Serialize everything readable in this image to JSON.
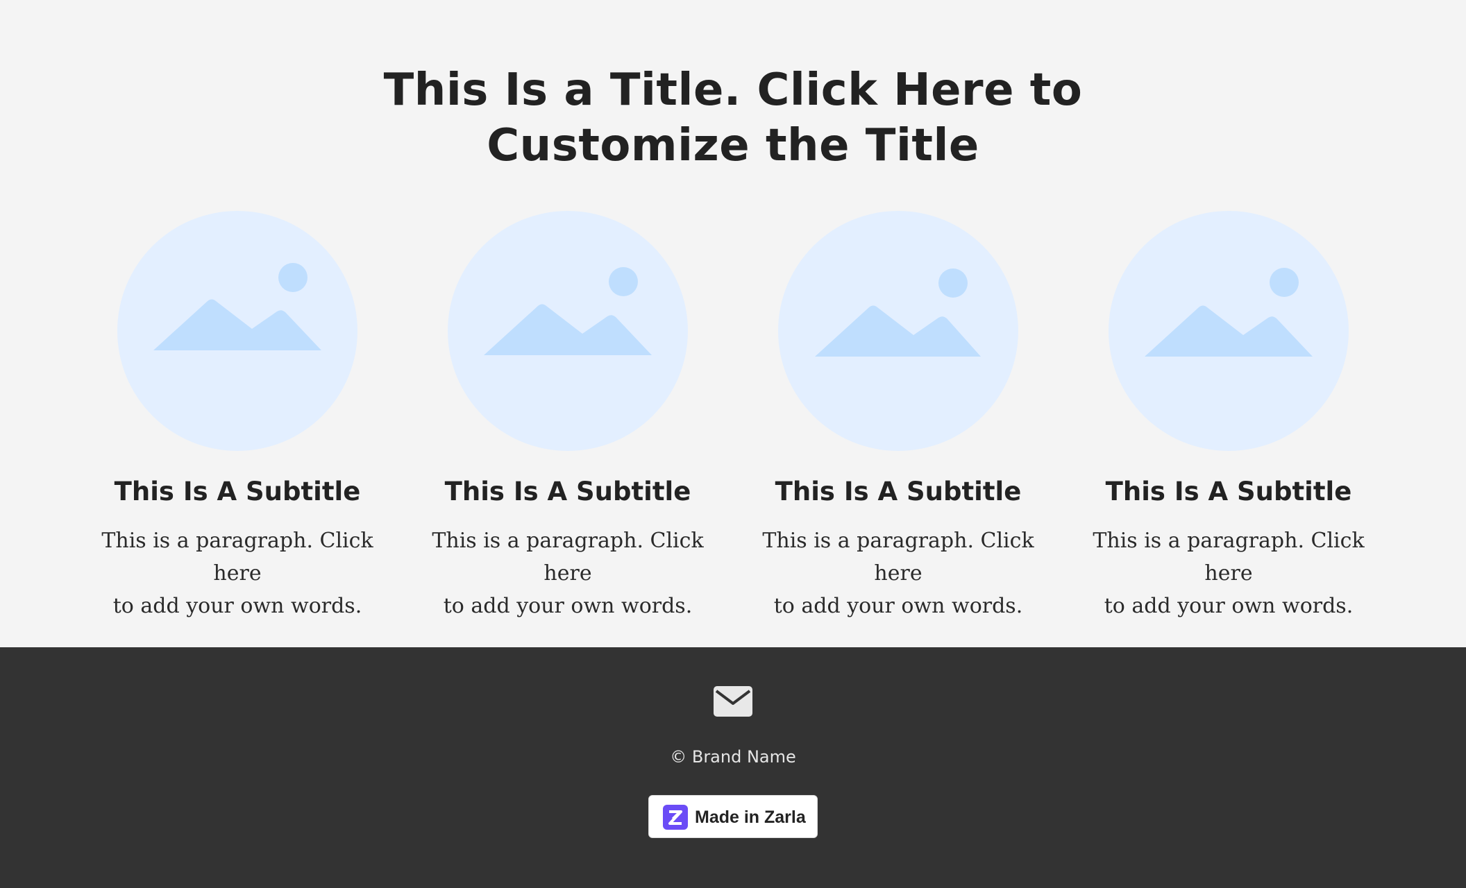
{
  "hero": {
    "title_line1": "This Is a Title. Click Here to",
    "title_line2": "Customize the Title"
  },
  "cards": [
    {
      "image_icon": "landscape-placeholder-icon",
      "subtitle": "This Is A Subtitle",
      "paragraph_line1": "This is a paragraph. Click here",
      "paragraph_line2": "to add your own words."
    },
    {
      "image_icon": "landscape-placeholder-icon",
      "subtitle": "This Is A Subtitle",
      "paragraph_line1": "This is a paragraph. Click here",
      "paragraph_line2": "to add your own words."
    },
    {
      "image_icon": "landscape-placeholder-icon",
      "subtitle": "This Is A Subtitle",
      "paragraph_line1": "This is a paragraph. Click here",
      "paragraph_line2": "to add your own words."
    },
    {
      "image_icon": "landscape-placeholder-icon",
      "subtitle": "This Is A Subtitle",
      "paragraph_line1": "This is a paragraph. Click here",
      "paragraph_line2": "to add your own words."
    }
  ],
  "footer": {
    "contact_icon": "envelope-icon",
    "copyright": "© Brand Name",
    "badge": {
      "logo_icon": "zarla-logo-icon",
      "label": "Made in Zarla"
    }
  },
  "colors": {
    "page_background": "#f4f4f4",
    "footer_background": "#333333",
    "placeholder_circle": "#e3efff",
    "placeholder_shape": "#bfdefe",
    "badge_logo": "#6b4cf6",
    "text": "#222222"
  }
}
